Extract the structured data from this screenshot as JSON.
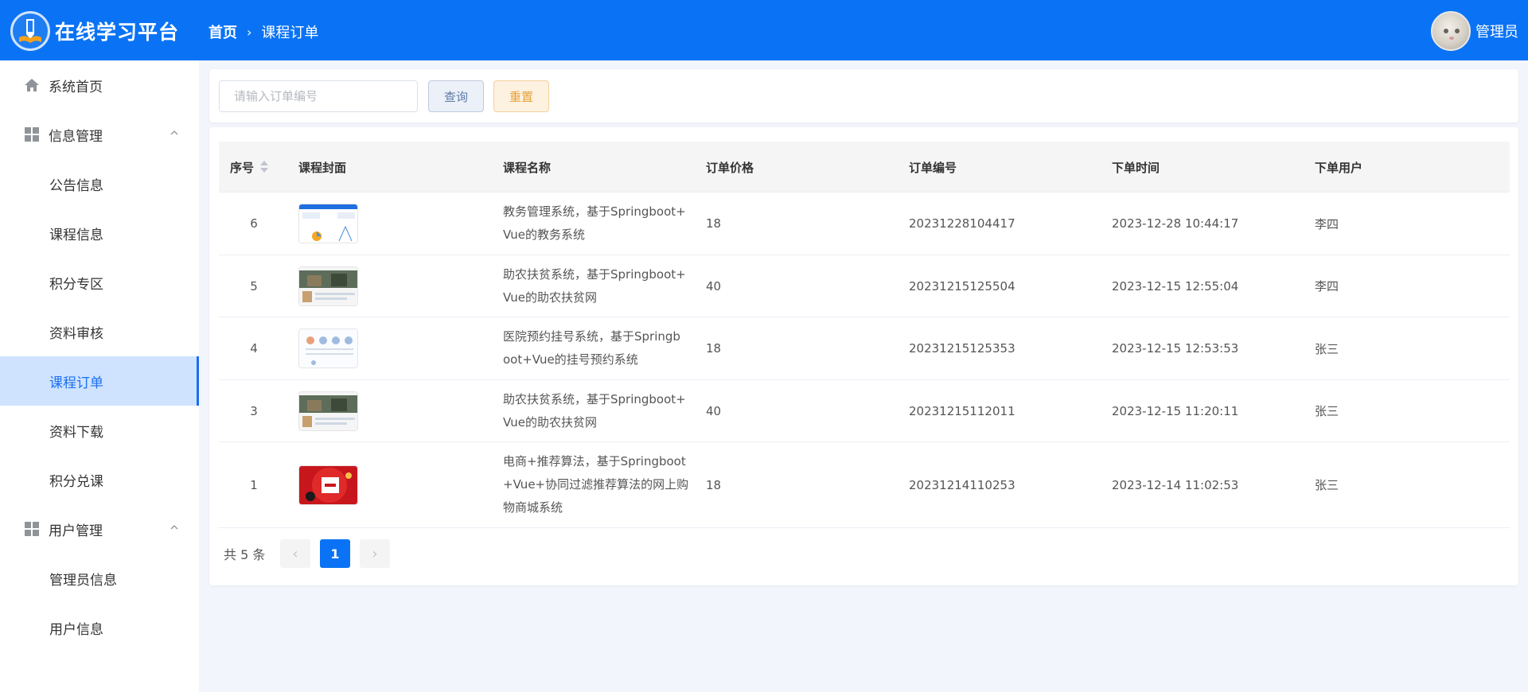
{
  "header": {
    "app_title": "在线学习平台",
    "breadcrumb_home": "首页",
    "breadcrumb_current": "课程订单",
    "user_name": "管理员",
    "bg_color": "#0a73f5"
  },
  "sidebar": {
    "items": [
      {
        "label": "系统首页",
        "icon": "home-icon"
      },
      {
        "label": "信息管理",
        "icon": "grid-icon"
      },
      {
        "label": "公告信息"
      },
      {
        "label": "课程信息"
      },
      {
        "label": "积分专区"
      },
      {
        "label": "资料审核"
      },
      {
        "label": "课程订单"
      },
      {
        "label": "资料下载"
      },
      {
        "label": "积分兑课"
      },
      {
        "label": "用户管理",
        "icon": "grid-icon"
      },
      {
        "label": "管理员信息"
      },
      {
        "label": "用户信息"
      }
    ],
    "active_color": "#1a6ff0"
  },
  "search": {
    "placeholder": "请输入订单编号",
    "query_label": "查询",
    "reset_label": "重置"
  },
  "table": {
    "columns": [
      "序号",
      "课程封面",
      "课程名称",
      "订单价格",
      "订单编号",
      "下单时间",
      "下单用户"
    ],
    "rows": [
      {
        "idx": "6",
        "name_lines": [
          "教务管理系统，基于Springboot+",
          "Vue的教务系统"
        ],
        "price": "18",
        "order_no": "20231228104417",
        "time": "2023-12-28 10:44:17",
        "user": "李四"
      },
      {
        "idx": "5",
        "name_lines": [
          "助农扶贫系统，基于Springboot+",
          "Vue的助农扶贫网"
        ],
        "price": "40",
        "order_no": "20231215125504",
        "time": "2023-12-15 12:55:04",
        "user": "李四"
      },
      {
        "idx": "4",
        "name_lines": [
          "医院预约挂号系统，基于Springb",
          "oot+Vue的挂号预约系统"
        ],
        "price": "18",
        "order_no": "20231215125353",
        "time": "2023-12-15 12:53:53",
        "user": "张三"
      },
      {
        "idx": "3",
        "name_lines": [
          "助农扶贫系统，基于Springboot+",
          "Vue的助农扶贫网"
        ],
        "price": "40",
        "order_no": "20231215112011",
        "time": "2023-12-15 11:20:11",
        "user": "张三"
      },
      {
        "idx": "1",
        "name_lines": [
          "电商+推荐算法，基于Springboot",
          "+Vue+协同过滤推荐算法的网上购",
          "物商城系统"
        ],
        "price": "18",
        "order_no": "20231214110253",
        "time": "2023-12-14 11:02:53",
        "user": "张三"
      }
    ]
  },
  "pagination": {
    "total_label": "共 5 条",
    "prev": "‹",
    "current": "1",
    "next": "›"
  }
}
